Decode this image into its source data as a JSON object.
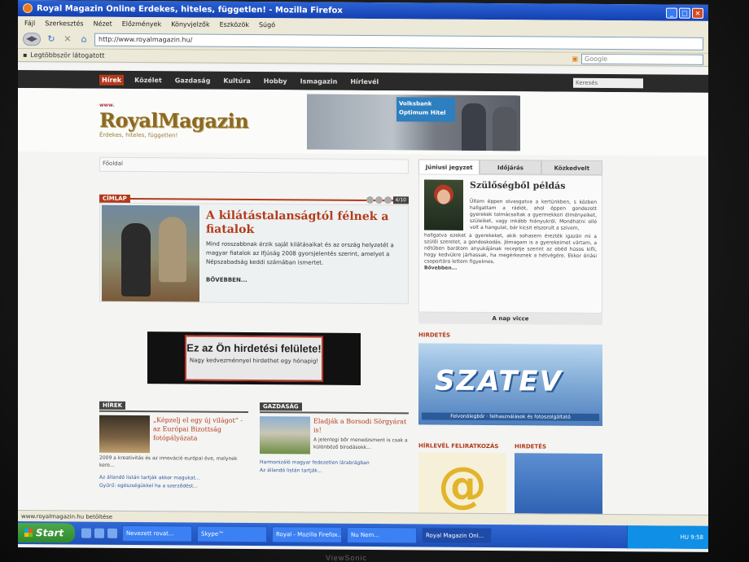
{
  "window": {
    "title": "Royal Magazin Online Érdekes, hiteles, független! - Mozilla Firefox",
    "menu": [
      "Fájl",
      "Szerkesztés",
      "Nézet",
      "Előzmények",
      "Könyvjelzők",
      "Eszközök",
      "Súgó"
    ],
    "url": "http://www.royalmagazin.hu/",
    "bookmark": "Legtöbbször látogatott",
    "search_engine": "Google",
    "status": "www.royalmagazin.hu betöltése"
  },
  "site": {
    "nav": [
      "Hírek",
      "Közélet",
      "Gazdaság",
      "Kultúra",
      "Hobby",
      "Ismagazin",
      "Hírlevél"
    ],
    "search_placeholder": "Keresés",
    "logo_www": "www.",
    "logo": "RoyalMagazin",
    "tagline": "Érdekes, hiteles, független!",
    "banner_text": "Volksbank Optimum Hitel",
    "breadcrumb": "Főoldal"
  },
  "feature": {
    "label": "CÍMLAP",
    "counter": "4/10",
    "title": "A kilátástalanságtól félnek a fiatalok",
    "desc": "Mind rosszabbnak érzik saját kilátásaikat és az ország helyzetét a magyar fiatalok az Ifjúság 2008 gyorsjelentés szerint, amelyet a Népszabadság keddi számában ismertet.",
    "more": "BŐVEBBEN..."
  },
  "ad": {
    "title": "Ez az Ön hirdetési felülete!",
    "sub": "Nagy kedvezménnyel hirdethet egy hónapig!"
  },
  "news": {
    "label": "HÍREK",
    "title": "„Képzelj el egy új világot” - az Európai Bizottság fotópályázata",
    "desc": "2009 a kreativitás és az innováció európai éve, melynek kere...",
    "links": [
      "Az állandó listán tartják akkor magukat...",
      "Gyűrű: egészségükkel ha a szerződést..."
    ]
  },
  "economy": {
    "label": "GAZDASÁG",
    "title": "Eladják a Borsodi Sörgyárat is!",
    "desc": "A jelenlegi bőr menedzsment is csak a különböző bírodásokk...",
    "links": [
      "Harmonizáló magyar fedezetlen lárabrágban",
      "Az állandó listán tartják..."
    ]
  },
  "opinion": {
    "tabs": [
      "Júniusi jegyzet",
      "Időjárás",
      "Közkedvelt"
    ],
    "title": "Szülőségből példás",
    "text_top": "Ültem éppen olvasgatva a kertünkben, s közben hallgattam a rádiót, ahol éppen gondozott gyerekek tolmácsoltak a gyermekkori élményeiket, szüleiket, vagy inkább hiányukról. Mondhatni olló volt a hangulat, bár kicsit elszorult a szívem,",
    "text_bottom": "hallgatva ezeket a gyerekeket, akik sohasem érezték igazán mi a szülői szeretet, a gondoskodás. Jómagam is a gyerekeimet vártam, a nőtűben barátom anyukájának receptje szerint az ebéd húsos kifli, hogy kedvükre járhassak, ha megérkeznek a hétvégére. Ekkor óriási csoportára lettem figyelmes.",
    "more": "Bővebben...",
    "quote": "A nap vicce"
  },
  "sidebar": {
    "ad_label": "HIRDETÉS",
    "szatev": "SZATEV",
    "szatev_sub": "Felvonólegbőr · felhasználások és fotoszolgáltató",
    "newsletter_label": "HÍRLEVÉL FELIRATKOZÁS",
    "ad_label2": "HIRDETÉS"
  },
  "taskbar": {
    "start": "Start",
    "tasks": [
      "Nevezett rovat...",
      "Skype™",
      "Royal - Mozilla Firefox...",
      "Nu Nem...",
      "Royal Magazin Onl..."
    ],
    "clock": "HU  9:58"
  },
  "monitor_brand": "ViewSonic"
}
